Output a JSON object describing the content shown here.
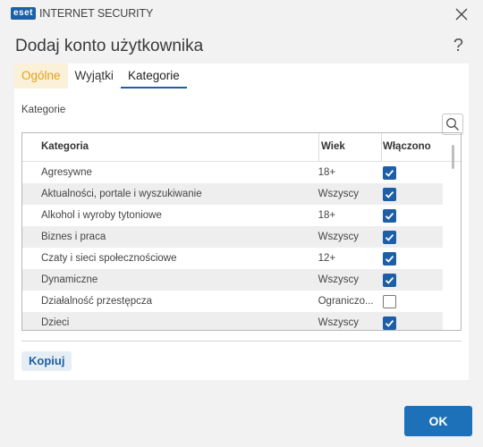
{
  "window": {
    "logo_text": "eset",
    "app_name": "INTERNET SECURITY"
  },
  "page": {
    "title": "Dodaj konto użytkownika",
    "help": "?"
  },
  "tabs": [
    {
      "label": "Ogólne"
    },
    {
      "label": "Wyjątki"
    },
    {
      "label": "Kategorie",
      "active": true
    }
  ],
  "section": {
    "label": "Kategorie"
  },
  "table": {
    "headers": {
      "category": "Kategoria",
      "age": "Wiek",
      "enabled": "Włączono"
    },
    "rows": [
      {
        "category": "Agresywne",
        "age": "18+",
        "enabled": true
      },
      {
        "category": "Aktualności, portale i wyszukiwanie",
        "age": "Wszyscy",
        "enabled": true
      },
      {
        "category": "Alkohol i wyroby tytoniowe",
        "age": "18+",
        "enabled": true
      },
      {
        "category": "Biznes i praca",
        "age": "Wszyscy",
        "enabled": true
      },
      {
        "category": "Czaty i sieci społecznościowe",
        "age": "12+",
        "enabled": true
      },
      {
        "category": "Dynamiczne",
        "age": "Wszyscy",
        "enabled": true
      },
      {
        "category": "Działalność przestępcza",
        "age": "Ograniczo...",
        "enabled": false
      },
      {
        "category": "Dzieci",
        "age": "Wszyscy",
        "enabled": true
      }
    ]
  },
  "buttons": {
    "copy": "Kopiuj",
    "ok": "OK"
  },
  "colors": {
    "accent": "#1d5fa6",
    "ok_button": "#1d71b8",
    "general_tab_text": "#e0a21a",
    "general_tab_bg": "#fbf1d9"
  }
}
